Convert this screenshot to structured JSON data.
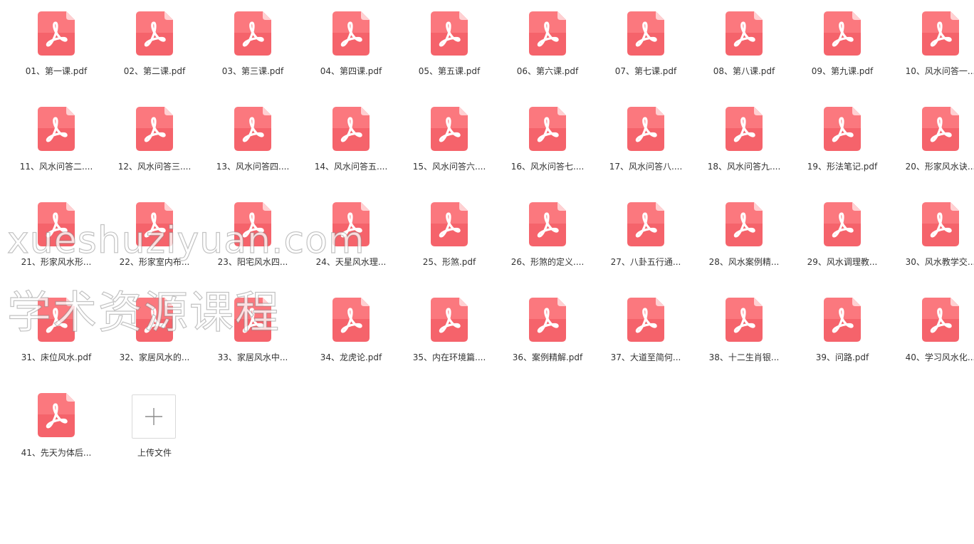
{
  "files": [
    "01、第一课.pdf",
    "02、第二课.pdf",
    "03、第三课.pdf",
    "04、第四课.pdf",
    "05、第五课.pdf",
    "06、第六课.pdf",
    "07、第七课.pdf",
    "08、第八课.pdf",
    "09、第九课.pdf",
    "10、风水问答一...",
    "11、风水问答二....",
    "12、风水问答三....",
    "13、风水问答四....",
    "14、风水问答五....",
    "15、风水问答六....",
    "16、风水问答七....",
    "17、风水问答八....",
    "18、风水问答九....",
    "19、形法笔记.pdf",
    "20、形家风水诀...",
    "21、形家风水形...",
    "22、形家室内布...",
    "23、阳宅风水四...",
    "24、天星风水理...",
    "25、形煞.pdf",
    "26、形煞的定义....",
    "27、八卦五行通...",
    "28、风水案例精...",
    "29、风水调理教...",
    "30、风水教学交...",
    "31、床位风水.pdf",
    "32、家居风水的...",
    "33、家居风水中...",
    "34、龙虎论.pdf",
    "35、内在环境篇....",
    "36、案例精解.pdf",
    "37、大道至简何...",
    "38、十二生肖银...",
    "39、问路.pdf",
    "40、学习风水化...",
    "41、先天为体后..."
  ],
  "upload": {
    "label": "上传文件"
  },
  "file_icon": "pdf-file-icon",
  "upload_icon": "plus-icon",
  "colors": {
    "pdf_top": "#ff8a8e",
    "pdf_bottom": "#f5636b",
    "label": "#333333",
    "upload_border": "#d9d9d9"
  },
  "watermark": {
    "line1": "xueshuziyuan.com",
    "line2": "学术资源课程"
  }
}
